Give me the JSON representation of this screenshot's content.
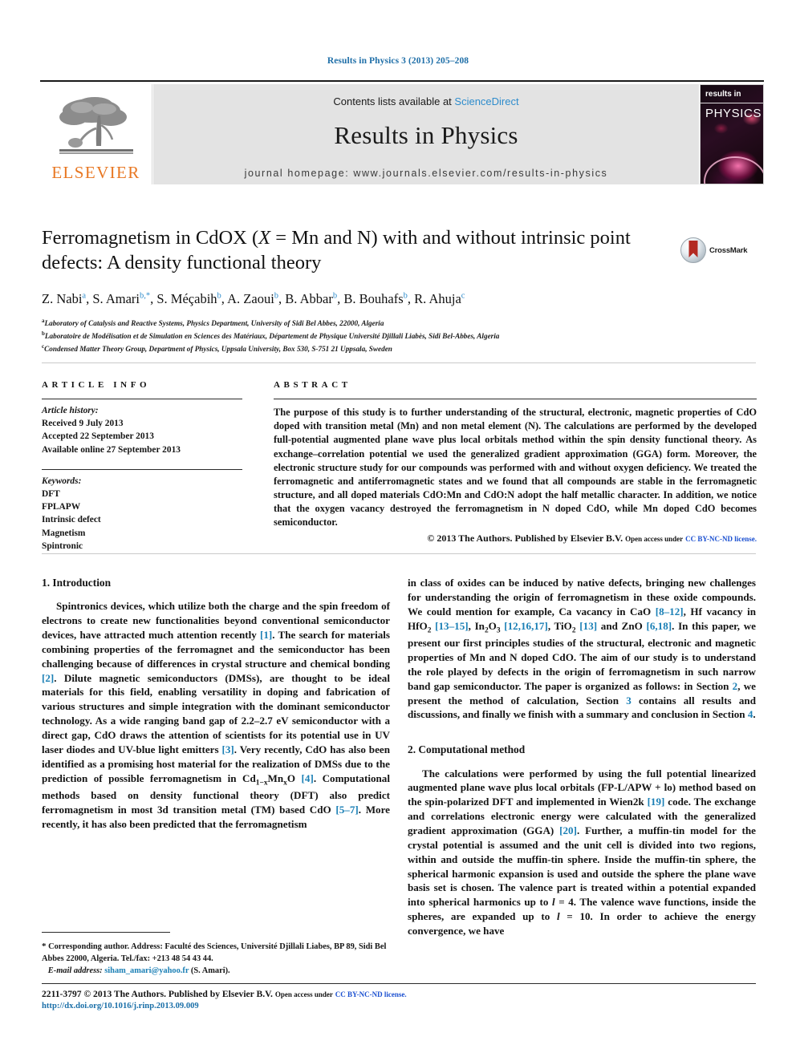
{
  "running_head": "Results in Physics 3 (2013) 205–208",
  "masthead": {
    "publisher_logo_label": "ELSEVIER",
    "contents_prefix": "Contents lists available at ",
    "contents_link": "ScienceDirect",
    "journal_title": "Results in Physics",
    "homepage": "journal homepage: www.journals.elsevier.com/results-in-physics",
    "cover": {
      "line1": "results in",
      "line2": "PHYSICS"
    }
  },
  "article": {
    "title_line1_a": "Ferromagnetism in CdOX (",
    "title_line1_x": "X",
    "title_line1_b": " = Mn and N) with and without intrinsic",
    "title_line2": "point defects: A density functional theory",
    "crossmark_label": "CrossMark",
    "authors": [
      {
        "name": "Z. Nabi",
        "sup": "a"
      },
      {
        "name": "S. Amari",
        "sup": "b,*"
      },
      {
        "name": "S. Méçabih",
        "sup": "b"
      },
      {
        "name": "A. Zaoui",
        "sup": "b"
      },
      {
        "name": "B. Abbar",
        "sup": "b"
      },
      {
        "name": "B. Bouhafs",
        "sup": "b"
      },
      {
        "name": "R. Ahuja",
        "sup": "c"
      }
    ],
    "affiliations": [
      {
        "marker": "a",
        "text": "Laboratory of Catalysis and Reactive Systems, Physics Department, University of Sidi Bel Abbes, 22000, Algeria"
      },
      {
        "marker": "b",
        "text": "Laboratoire de Modélisation et de Simulation en Sciences des Matériaux, Département de Physique Université Djillali Liabès, Sidi Bel-Abbes, Algeria"
      },
      {
        "marker": "c",
        "text": "Condensed Matter Theory Group, Department of Physics, Uppsala University, Box 530, S-751 21 Uppsala, Sweden"
      }
    ]
  },
  "article_info": {
    "heading": "ARTICLE INFO",
    "history_label": "Article history:",
    "history": [
      "Received 9 July 2013",
      "Accepted 22 September 2013",
      "Available online 27 September 2013"
    ],
    "keywords_label": "Keywords:",
    "keywords": [
      "DFT",
      "FPLAPW",
      "Intrinsic defect",
      "Magnetism",
      "Spintronic"
    ]
  },
  "abstract": {
    "heading": "ABSTRACT",
    "text": "The purpose of this study is to further understanding of the structural, electronic, magnetic properties of CdO doped with transition metal (Mn) and non metal element (N). The calculations are performed by the developed full-potential augmented plane wave plus local orbitals method within the spin density functional theory. As exchange–correlation potential we used the generalized gradient approximation (GGA) form. Moreover, the electronic structure study for our compounds was performed with and without oxygen deficiency. We treated the ferromagnetic and antiferromagnetic states and we found that all compounds are stable in the ferromagnetic structure, and all doped materials CdO:Mn and CdO:N adopt the half metallic character. In addition, we notice that the oxygen vacancy destroyed the ferromagnetism in N doped CdO, while Mn doped CdO becomes semiconductor.",
    "copyright_main": "© 2013 The Authors. Published by Elsevier B.V.",
    "copyright_open": "Open access under",
    "copyright_license": "CC BY-NC-ND license."
  },
  "sections": {
    "intro_heading": "1. Introduction",
    "intro_p1_parts": [
      {
        "t": "Spintronics devices, which utilize both the charge and the spin freedom of electrons to create new functionalities beyond conventional semiconductor devices, have attracted much attention recently "
      },
      {
        "r": "[1]"
      },
      {
        "t": ". The search for materials combining properties of the ferromagnet and the semiconductor has been challenging because of differences in crystal structure and chemical bonding "
      },
      {
        "r": "[2]"
      },
      {
        "t": ". Dilute magnetic semiconductors (DMSs), are thought to be ideal materials for this field, enabling versatility in doping and fabrication of various structures and simple integration with the dominant semiconductor technology. As a wide ranging band gap of 2.2–2.7 eV semiconductor with a direct gap, CdO draws the attention of scientists for its potential use in UV laser diodes and UV-blue light emitters "
      },
      {
        "r": "[3]"
      },
      {
        "t": ". Very recently, CdO has also been identified as a promising host material for the realization of DMSs due to the prediction of possible ferromagnetism in Cd"
      },
      {
        "sub": "1−x"
      },
      {
        "t": "Mn"
      },
      {
        "sub": "x"
      },
      {
        "t": "O "
      },
      {
        "r": "[4]"
      },
      {
        "t": ". Computational methods based on density functional theory (DFT) also predict ferromagnetism in most 3d transition metal (TM) based CdO "
      },
      {
        "r": "[5–7]"
      },
      {
        "t": ". More recently, it has also been predicted that the ferromagnetism in class of oxides can be induced by native defects, bringing new challenges for understanding the origin of ferromagnetism in these oxide compounds. We could mention for example, Ca vacancy in CaO "
      },
      {
        "r": "[8–12]"
      },
      {
        "t": ", Hf vacancy in HfO"
      },
      {
        "sub": "2"
      },
      {
        "t": " "
      },
      {
        "r": "[13–15]"
      },
      {
        "t": ", In"
      },
      {
        "sub": "2"
      },
      {
        "t": "O"
      },
      {
        "sub": "3"
      },
      {
        "t": " "
      },
      {
        "r": "[12,16,17]"
      },
      {
        "t": ", TiO"
      },
      {
        "sub": "2"
      },
      {
        "t": " "
      },
      {
        "r": "[13]"
      },
      {
        "t": " and ZnO "
      },
      {
        "r": "[6,18]"
      },
      {
        "t": ". In this paper, we present our first principles studies of the structural, electronic and magnetic properties of Mn and N doped CdO. The aim of our study is to understand the role played by defects in the origin of ferromagnetism in such narrow band gap semiconductor. The paper is organized as follows: in Section "
      },
      {
        "r": "2"
      },
      {
        "t": ", we present the method of calculation, Section "
      },
      {
        "r": "3"
      },
      {
        "t": " contains all results and discussions, and finally we finish with a summary and conclusion in Section "
      },
      {
        "r": "4"
      },
      {
        "t": "."
      }
    ],
    "method_heading": "2. Computational method",
    "method_p1_parts": [
      {
        "t": "The calculations were performed by using the full potential linearized augmented plane wave plus local orbitals (FP-L/APW + lo) method based on the spin-polarized DFT and implemented in Wien2k "
      },
      {
        "r": "[19]"
      },
      {
        "t": " code. The exchange and correlations electronic energy were calculated with the generalized gradient approximation (GGA) "
      },
      {
        "r": "[20]"
      },
      {
        "t": ". Further, a muffin-tin model for the crystal potential is assumed and the unit cell is divided into two regions, within and outside the muffin-tin sphere. Inside the muffin-tin sphere, the spherical harmonic expansion is used and outside the sphere the plane wave basis set is chosen. The valence part is treated within a potential expanded into spherical harmonics up to "
      },
      {
        "i": "l"
      },
      {
        "t": " = 4. The valence wave functions, inside the spheres, are expanded up to "
      },
      {
        "i": "l"
      },
      {
        "t": " = 10. In order to achieve the energy convergence, we have"
      }
    ]
  },
  "footnote": {
    "star": "*",
    "corresponding": " Corresponding author. Address: Faculté des Sciences, Université Djillali Liabes, BP 89, Sidi Bel Abbes 22000, Algeria. Tel./fax: +213 48 54 43 44.",
    "email_label": "E-mail address:",
    "email": "siham_amari@yahoo.fr",
    "email_suffix": " (S. Amari)."
  },
  "footer": {
    "issn_line": "2211-3797 © 2013 The Authors. Published by Elsevier B.V.",
    "open_access": "Open access under",
    "license": "CC BY-NC-ND license.",
    "doi": "http://dx.doi.org/10.1016/j.rinp.2013.09.009"
  }
}
